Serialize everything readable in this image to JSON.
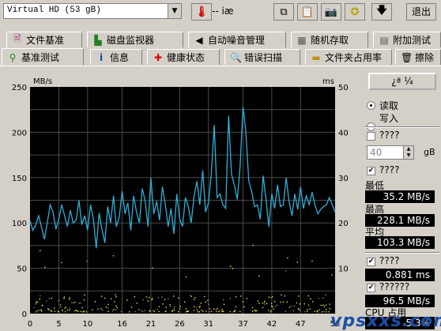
{
  "toolbar": {
    "drive": "Virtual HD (53 gB)",
    "temperature": "-- iæ",
    "exit_label": "退出"
  },
  "tabs_top": [
    {
      "label": "文件基准",
      "icon": "file-benchmark-icon"
    },
    {
      "label": "磁盘监视器",
      "icon": "disk-monitor-icon"
    },
    {
      "label": "自动噪音管理",
      "icon": "speaker-icon"
    },
    {
      "label": "随机存取",
      "icon": "random-access-icon"
    },
    {
      "label": "附加测试",
      "icon": "extra-tests-icon"
    }
  ],
  "tabs_bottom": [
    {
      "label": "基准测试",
      "icon": "benchmark-icon"
    },
    {
      "label": "信息",
      "icon": "info-icon"
    },
    {
      "label": "健康状态",
      "icon": "health-icon"
    },
    {
      "label": "错误扫描",
      "icon": "error-scan-icon"
    },
    {
      "label": "文件夹占用率",
      "icon": "folder-usage-icon"
    },
    {
      "label": "擦除",
      "icon": "erase-icon"
    }
  ],
  "panel": {
    "start_label": "¿ª ¼",
    "read_label": "读取",
    "write_label": "写入",
    "opt1_label": "????",
    "block_value": "40",
    "block_unit": "gB",
    "opt2_label": "????",
    "min_label": "最低",
    "min_value": "35.2 MB/s",
    "max_label": "最高",
    "max_value": "228.1 MB/s",
    "avg_label": "平均",
    "avg_value": "103.3 MB/s",
    "access_label": "????",
    "access_value": "0.881 ms",
    "burst_label": "??????",
    "burst_value": "96.5 MB/s",
    "cpu_label": "CPU 占用",
    "cpu_value": "5.3%"
  },
  "watermark": "vpsxxs.com",
  "chart_data": {
    "type": "line",
    "ylabel": "MB/s",
    "y2label": "ms",
    "ylim": [
      0,
      250
    ],
    "y2lim": [
      0,
      50
    ],
    "yticks": [
      0,
      50,
      100,
      150,
      200,
      250
    ],
    "y2ticks": [
      10,
      20,
      30,
      40,
      50
    ],
    "xlim": [
      0,
      53
    ],
    "xticks": [
      0,
      5,
      10,
      16,
      21,
      26,
      31,
      37,
      42,
      47,
      53
    ],
    "grid": true,
    "series": [
      {
        "color": "#2bb0d8",
        "x": [
          0,
          0.5,
          1,
          1.5,
          2,
          2.5,
          3,
          3.5,
          4,
          4.5,
          5,
          5.5,
          6,
          6.5,
          7,
          7.5,
          8,
          8.5,
          9,
          9.5,
          10,
          10.5,
          11,
          11.5,
          12,
          12.5,
          13,
          13.5,
          14,
          14.5,
          15,
          15.5,
          16,
          16.5,
          17,
          17.5,
          18,
          18.5,
          19,
          19.5,
          20,
          20.5,
          21,
          21.5,
          22,
          22.5,
          23,
          23.5,
          24,
          24.5,
          25,
          25.5,
          26,
          26.5,
          27,
          27.5,
          28,
          28.5,
          29,
          29.5,
          30,
          30.5,
          31,
          31.5,
          32,
          32.5,
          33,
          33.5,
          34,
          34.5,
          35,
          35.5,
          36,
          36.5,
          37,
          37.5,
          38,
          38.5,
          39,
          39.5,
          40,
          40.5,
          41,
          41.5,
          42,
          42.5,
          43,
          43.5,
          44,
          44.5,
          45,
          45.5,
          46,
          46.5,
          47,
          47.5,
          48,
          48.5,
          49,
          49.5,
          50,
          50.5,
          51,
          51.5,
          52,
          52.5,
          53
        ],
        "y": [
          102,
          92,
          98,
          108,
          95,
          82,
          100,
          120,
          112,
          93,
          104,
          120,
          108,
          96,
          114,
          100,
          103,
          125,
          98,
          108,
          92,
          120,
          105,
          72,
          111,
          93,
          78,
          118,
          100,
          130,
          96,
          106,
          135,
          110,
          122,
          92,
          130,
          112,
          100,
          138,
          124,
          96,
          150,
          110,
          124,
          103,
          140,
          120,
          96,
          116,
          88,
          132,
          104,
          96,
          128,
          118,
          100,
          130,
          146,
          120,
          158,
          112,
          122,
          155,
          208,
          128,
          132,
          120,
          116,
          218,
          154,
          142,
          126,
          162,
          228,
          200,
          146,
          135,
          118,
          120,
          104,
          152,
          126,
          96,
          132,
          116,
          142,
          118,
          120,
          150,
          124,
          108,
          132,
          115,
          140,
          116,
          130,
          120,
          134,
          120,
          110,
          115,
          118,
          120,
          128,
          120,
          112
        ]
      }
    ]
  }
}
